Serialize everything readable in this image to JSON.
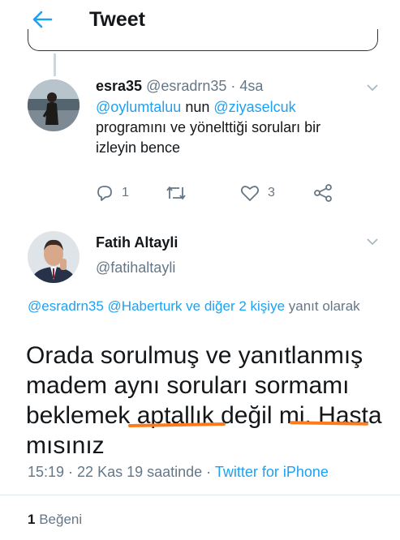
{
  "header": {
    "title": "Tweet",
    "back_icon": "back-arrow-icon"
  },
  "tweet1": {
    "display_name": "esra35",
    "handle": "@esradrn35",
    "separator": " · ",
    "time": "4sa",
    "mention1": "@oylumtaluu",
    "mid_text": " nun ",
    "mention2": "@ziyaselcuk",
    "body_rest": "programını ve yönelttiği soruları bir izleyin bence",
    "reply_count": "1",
    "like_count": "3"
  },
  "tweet2": {
    "display_name": "Fatih Altayli",
    "handle": "@fatihaltayli",
    "reply_to_links": "@esradrn35 @Haberturk ve diğer 2 kişiye",
    "reply_to_suffix": " yanıt olarak",
    "text_line1": "Orada sorulmuş ve yanıtlanmış",
    "text_line2": "madem aynı soruları sormamı",
    "text_line3": "beklemek aptallık değil mi. Hasta",
    "text_line4": "mısınız",
    "meta_time": "15:19 · 22 Kas 19 saatinde · ",
    "meta_app": "Twitter for iPhone",
    "like_count": "1",
    "like_label": " Beğeni"
  },
  "colors": {
    "accent": "#1da1f2",
    "muted": "#657786",
    "highlight_underline": "#ff7a1a"
  }
}
